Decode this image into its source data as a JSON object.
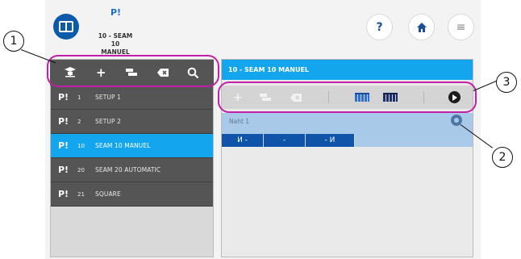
{
  "header": {
    "app_icon": "program-manager-icon",
    "program_badge": "P!",
    "program_name_line1": "10 - SEAM 10",
    "program_name_line2": "MANUEL",
    "help_label": "?",
    "home_icon": "home-icon",
    "menu_label": "≡"
  },
  "left_toolbar": {
    "items": [
      {
        "icon": "program-tree-icon",
        "glyph": "⛫"
      },
      {
        "icon": "add-icon",
        "glyph": "+"
      },
      {
        "icon": "copy-icon",
        "glyph": "▬"
      },
      {
        "icon": "delete-icon",
        "glyph": "⌫"
      },
      {
        "icon": "search-icon",
        "glyph": "⚲"
      }
    ]
  },
  "programs": [
    {
      "badge": "P!",
      "num": "1",
      "label": "SETUP 1",
      "active": false
    },
    {
      "badge": "P!",
      "num": "2",
      "label": "SETUP 2",
      "active": false
    },
    {
      "badge": "P!",
      "num": "10",
      "label": "SEAM 10 MANUEL",
      "active": true
    },
    {
      "badge": "P!",
      "num": "20",
      "label": "SEAM 20 AUTOMATIC",
      "active": false
    },
    {
      "badge": "P!",
      "num": "21",
      "label": "SQUARE",
      "active": false
    }
  ],
  "right_panel": {
    "title": "10 - SEAM 10 MANUEL",
    "toolbar": {
      "add": "+",
      "copy": "▬",
      "delete": "⌫"
    },
    "seam": {
      "name": "Naht 1",
      "segments": [
        "И -",
        "-",
        "- И"
      ]
    }
  },
  "callouts": {
    "one": "①",
    "two": "②",
    "three": "③"
  },
  "colors": {
    "accent": "#13a6ef",
    "header_icon": "#0d5aa8",
    "dark_list": "#555555",
    "seam_track": "#0f54a8",
    "callout": "#c21fa7"
  }
}
